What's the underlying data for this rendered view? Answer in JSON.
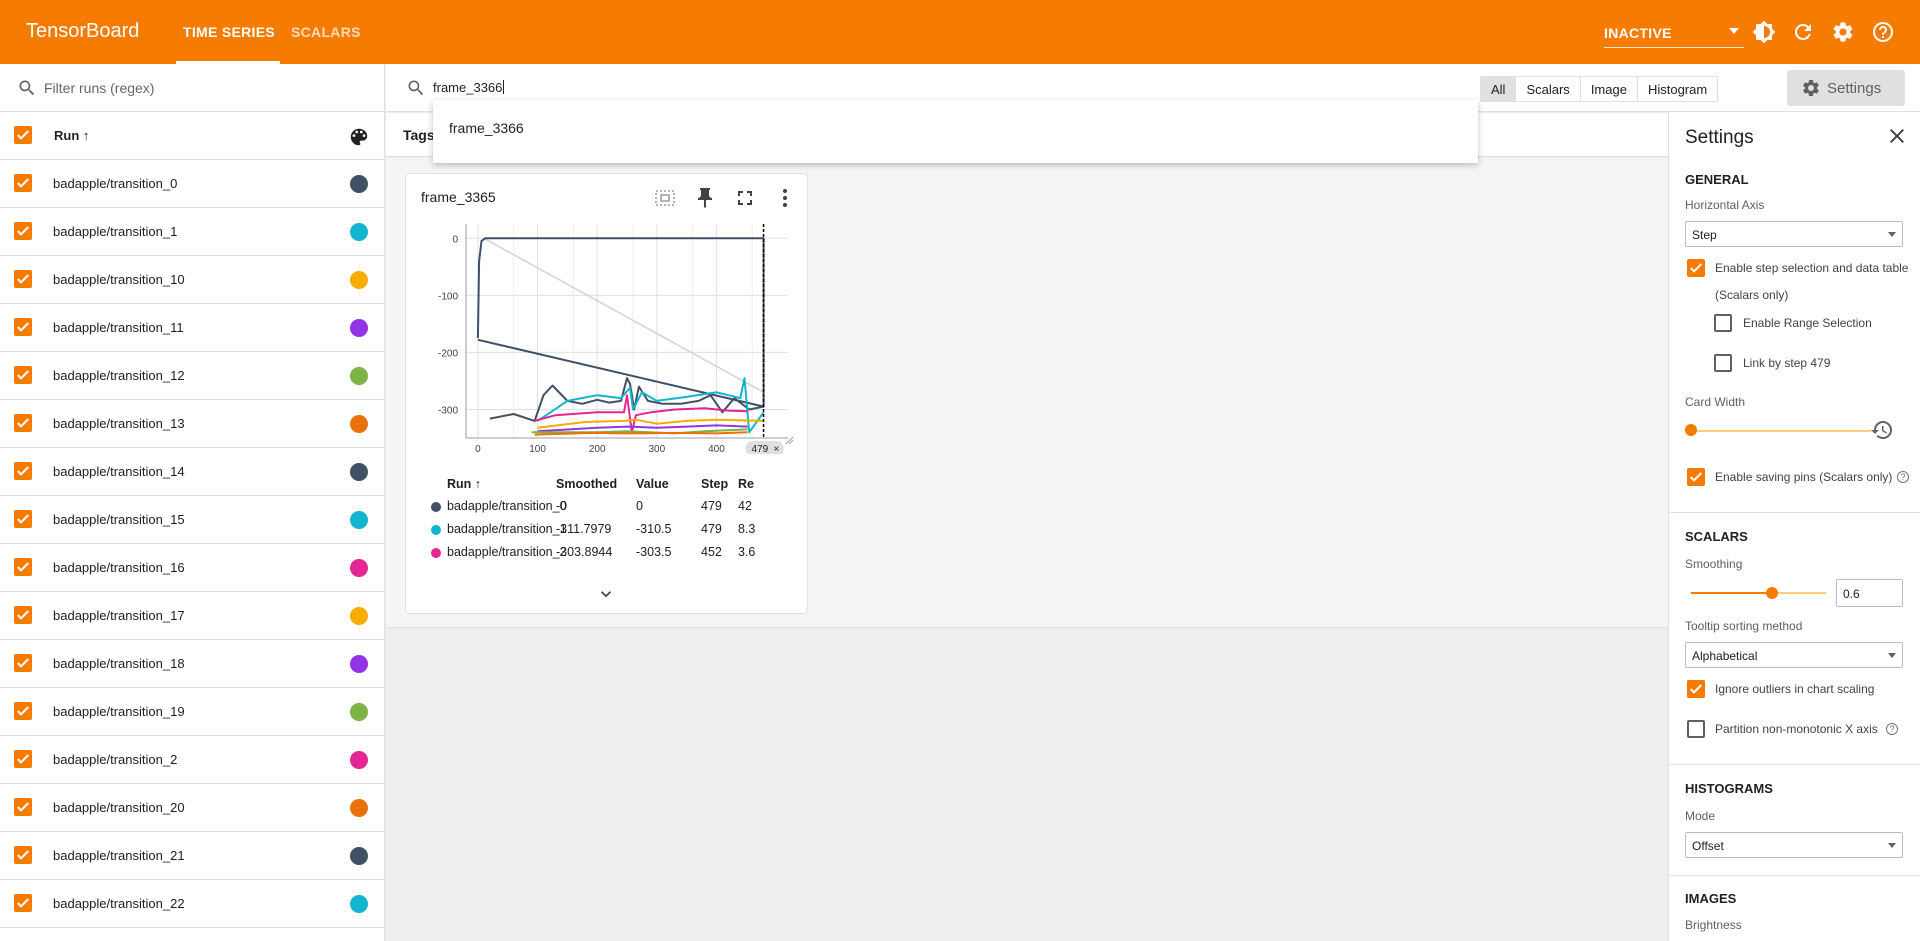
{
  "header": {
    "brand": "TensorBoard",
    "tabs": [
      {
        "label": "TIME SERIES"
      },
      {
        "label": "SCALARS"
      }
    ],
    "status_select": "INACTIVE",
    "accent": "#f57c00"
  },
  "left": {
    "filter_placeholder": "Filter runs (regex)",
    "run_header": "Run ↑",
    "runs": [
      {
        "name": "badapple/transition_0",
        "color": "#425066"
      },
      {
        "name": "badapple/transition_1",
        "color": "#12b5cb"
      },
      {
        "name": "badapple/transition_10",
        "color": "#f9ab00"
      },
      {
        "name": "badapple/transition_11",
        "color": "#9334e6"
      },
      {
        "name": "badapple/transition_12",
        "color": "#7cb342"
      },
      {
        "name": "badapple/transition_13",
        "color": "#e8710a"
      },
      {
        "name": "badapple/transition_14",
        "color": "#425066"
      },
      {
        "name": "badapple/transition_15",
        "color": "#12b5cb"
      },
      {
        "name": "badapple/transition_16",
        "color": "#e52592"
      },
      {
        "name": "badapple/transition_17",
        "color": "#f9ab00"
      },
      {
        "name": "badapple/transition_18",
        "color": "#9334e6"
      },
      {
        "name": "badapple/transition_19",
        "color": "#7cb342"
      },
      {
        "name": "badapple/transition_2",
        "color": "#e52592"
      },
      {
        "name": "badapple/transition_20",
        "color": "#e8710a"
      },
      {
        "name": "badapple/transition_21",
        "color": "#425066"
      },
      {
        "name": "badapple/transition_22",
        "color": "#12b5cb"
      }
    ]
  },
  "toolbar": {
    "query": "frame_3366",
    "types": [
      "All",
      "Scalars",
      "Image",
      "Histogram"
    ],
    "settings_label": "Settings"
  },
  "tags_label": "Tags",
  "dropdown": {
    "option": "frame_3366"
  },
  "card": {
    "title": "frame_3365",
    "step_chip": "479",
    "table": {
      "headers": [
        "Run ↑",
        "Smoothed",
        "Value",
        "Step",
        "Re"
      ],
      "rows": [
        {
          "run": "badapple/transition_0",
          "smoothed": "-0",
          "value": "0",
          "step": "479",
          "rel": "42",
          "color": "#425066"
        },
        {
          "run": "badapple/transition_1",
          "smoothed": "-311.7979",
          "value": "-310.5",
          "step": "479",
          "rel": "8.3",
          "color": "#12b5cb"
        },
        {
          "run": "badapple/transition_2",
          "smoothed": "-303.8944",
          "value": "-303.5",
          "step": "452",
          "rel": "3.6",
          "color": "#e52592"
        }
      ]
    }
  },
  "chart_data": {
    "type": "line",
    "title": "frame_3365",
    "xlim": [
      -20,
      520
    ],
    "ylim": [
      -350,
      25
    ],
    "x_ticks": [
      0,
      100,
      200,
      300,
      400
    ],
    "y_ticks": [
      0,
      -100,
      -200,
      -300
    ],
    "grid": true,
    "series": [
      {
        "color": "#cfd3dc",
        "x": [
          10,
          479
        ],
        "y": [
          0,
          -270
        ]
      },
      {
        "color": "#425066",
        "x": [
          0,
          2,
          6,
          12,
          20,
          479,
          479,
          0
        ],
        "y": [
          -175,
          -40,
          -5,
          0,
          0,
          0,
          -295,
          -178
        ]
      },
      {
        "color": "#425066",
        "x": [
          20,
          60,
          95,
          110,
          125,
          150,
          175,
          200,
          220,
          240,
          250,
          255,
          262,
          270,
          285,
          310,
          340,
          370,
          390,
          410,
          430,
          455,
          479
        ],
        "y": [
          -316,
          -308,
          -320,
          -275,
          -258,
          -285,
          -290,
          -283,
          -288,
          -285,
          -245,
          -255,
          -300,
          -260,
          -285,
          -290,
          -290,
          -285,
          -275,
          -305,
          -280,
          -300,
          -295
        ]
      },
      {
        "color": "#12b5cb",
        "x": [
          100,
          150,
          200,
          240,
          255,
          260,
          275,
          300,
          350,
          400,
          420,
          440,
          447,
          455,
          479
        ],
        "y": [
          -320,
          -285,
          -275,
          -280,
          -262,
          -300,
          -270,
          -285,
          -278,
          -270,
          -275,
          -280,
          -245,
          -340,
          -305
        ]
      },
      {
        "color": "#e52592",
        "x": [
          95,
          130,
          200,
          245,
          250,
          258,
          265,
          290,
          330,
          380,
          420,
          452
        ],
        "y": [
          -320,
          -310,
          -305,
          -305,
          -275,
          -340,
          -310,
          -305,
          -300,
          -298,
          -302,
          -303
        ]
      },
      {
        "color": "#f9ab00",
        "x": [
          100,
          180,
          245,
          265,
          300,
          350,
          400,
          479
        ],
        "y": [
          -332,
          -322,
          -320,
          -318,
          -325,
          -320,
          -318,
          -320
        ]
      },
      {
        "color": "#9334e6",
        "x": [
          100,
          200,
          250,
          300,
          350,
          400,
          452
        ],
        "y": [
          -338,
          -332,
          -330,
          -332,
          -330,
          -328,
          -330
        ]
      },
      {
        "color": "#7cb342",
        "x": [
          90,
          200,
          250,
          330,
          380,
          452
        ],
        "y": [
          -340,
          -340,
          -338,
          -342,
          -338,
          -335
        ]
      },
      {
        "color": "#e8710a",
        "x": [
          95,
          190,
          250,
          330,
          400,
          452
        ],
        "y": [
          -344,
          -341,
          -342,
          -341,
          -342,
          -340
        ]
      }
    ]
  },
  "settings": {
    "title": "Settings",
    "general": "GENERAL",
    "horizontal_axis_label": "Horizontal Axis",
    "horizontal_axis_value": "Step",
    "enable_step_selection_line1": "Enable step selection and data table",
    "enable_step_selection_line2": "(Scalars only)",
    "enable_range_selection": "Enable Range Selection",
    "link_by_step": "Link by step 479",
    "card_width_label": "Card Width",
    "card_width_fraction": 0,
    "enable_saving_pins": "Enable saving pins (Scalars only)",
    "scalars": "SCALARS",
    "smoothing_label": "Smoothing",
    "smoothing_value": "0.6",
    "tooltip_sort_label": "Tooltip sorting method",
    "tooltip_sort_value": "Alphabetical",
    "ignore_outliers": "Ignore outliers in chart scaling",
    "partition_non_monotonic": "Partition non-monotonic X axis",
    "histograms": "HISTOGRAMS",
    "mode_label": "Mode",
    "mode_value": "Offset",
    "images": "IMAGES",
    "brightness_label": "Brightness"
  }
}
